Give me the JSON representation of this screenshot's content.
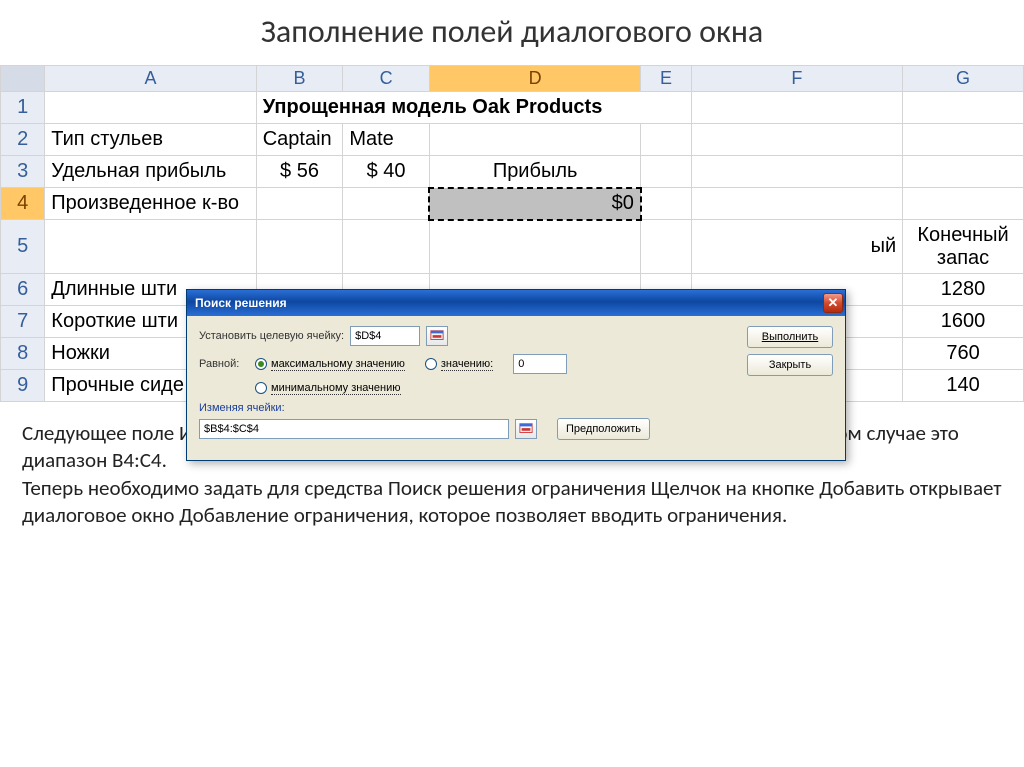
{
  "slide": {
    "title": "Заполнение полей диалогового окна"
  },
  "columns": [
    "A",
    "B",
    "C",
    "D",
    "E",
    "F",
    "G"
  ],
  "rows": {
    "r1": {
      "b": "Упрощенная модель Oak Products"
    },
    "r2": {
      "a": "Тип стульев",
      "b": "Captain",
      "c": "Mate"
    },
    "r3": {
      "a": "Удельная прибыль",
      "b": "$ 56",
      "c": "$ 40",
      "d": "Прибыль"
    },
    "r4": {
      "a": "Произведенное к-во",
      "d": "$0"
    },
    "r5": {
      "f_tail": "ый",
      "g": "Конечный запас"
    },
    "r6": {
      "a": "Длинные шти",
      "g": "1280"
    },
    "r7": {
      "a": "Короткие шти",
      "g": "1600"
    },
    "r8": {
      "a": "Ножки",
      "g": "760"
    },
    "r9": {
      "a": "Прочные сиде",
      "g": "140"
    }
  },
  "dialog": {
    "title": "Поиск решения",
    "target_label": "Установить целевую ячейку:",
    "target_value": "$D$4",
    "equal_label": "Равной:",
    "opt_max": "максимальному значению",
    "opt_val": "значению:",
    "opt_val_input": "0",
    "opt_min": "минимальному значению",
    "changing_label": "Изменяя ячейки:",
    "changing_value": "$B$4:$C$4",
    "btn_execute": "Выполнить",
    "btn_close": "Закрыть",
    "btn_guess": "Предположить"
  },
  "footer": {
    "text": "Следующее поле Изменяя ячейки позволяет указать переменные решения модели, в данном случае это диапазон В4:С4.\nТеперь необходимо задать для средства Поиск решения ограничения Щелчок на кнопке Добавить открывает диалоговое окно Добавление ограничения, которое  позволяет вводить ограничения."
  }
}
